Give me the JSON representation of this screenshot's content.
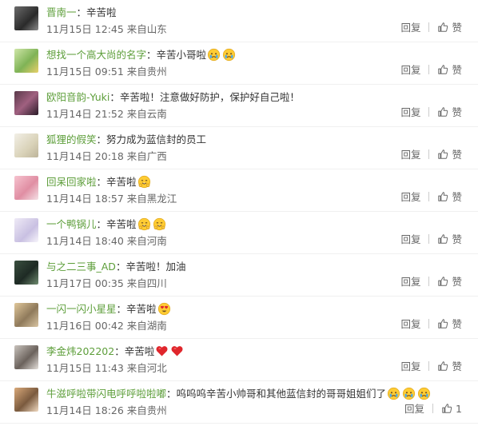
{
  "comments": [
    {
      "user": "晋南一",
      "text": "辛苦啦",
      "emojis": [],
      "time": "11月15日 12:45",
      "location": "来自山东",
      "reply": "回复",
      "like": "赞"
    },
    {
      "user": "想找一个高大尚的名字",
      "text": "辛苦小哥啦",
      "emojis": [
        "crying-face",
        "crying-face"
      ],
      "time": "11月15日 09:51",
      "location": "来自贵州",
      "reply": "回复",
      "like": "赞"
    },
    {
      "user": "欧阳音韵-Yuki",
      "text": "辛苦啦！注意做好防护，保护好自己啦！",
      "emojis": [],
      "time": "11月14日 21:52",
      "location": "来自云南",
      "reply": "回复",
      "like": "赞"
    },
    {
      "user": "狐狸的假笑",
      "text": "努力成为蓝信封的员工",
      "emojis": [],
      "time": "11月14日 20:18",
      "location": "来自广西",
      "reply": "回复",
      "like": "赞"
    },
    {
      "user": "回呆回家啦",
      "text": "辛苦啦",
      "emojis": [
        "hug-face"
      ],
      "time": "11月14日 18:57",
      "location": "来自黑龙江",
      "reply": "回复",
      "like": "赞"
    },
    {
      "user": "一个鸭锅儿",
      "text": "辛苦啦",
      "emojis": [
        "hug-face",
        "hug-face"
      ],
      "time": "11月14日 18:40",
      "location": "来自河南",
      "reply": "回复",
      "like": "赞"
    },
    {
      "user": "与之二三事_AD",
      "text": "辛苦啦！加油",
      "emojis": [],
      "time": "11月17日 00:35",
      "location": "来自四川",
      "reply": "回复",
      "like": "赞"
    },
    {
      "user": "一闪一闪小星星",
      "text": "辛苦啦",
      "emojis": [
        "heart-eyes-face"
      ],
      "time": "11月16日 00:42",
      "location": "来自湖南",
      "reply": "回复",
      "like": "赞"
    },
    {
      "user": "李金炜202202",
      "text": "辛苦啦",
      "emojis": [
        "red-heart",
        "red-heart"
      ],
      "time": "11月15日 11:43",
      "location": "来自河北",
      "reply": "回复",
      "like": "赞"
    },
    {
      "user": "牛滋呼啦带闪电呼呼啦啦嘟",
      "text": "呜呜呜辛苦小帅哥和其他蓝信封的哥哥姐姐们了",
      "emojis": [
        "crying-face",
        "crying-face",
        "crying-face"
      ],
      "time": "11月14日 18:26",
      "location": "来自贵州",
      "reply": "回复",
      "like": "1"
    }
  ],
  "colors": {
    "username": "#5d9e3a",
    "meta": "#666666",
    "divider": "#f0f0f0"
  }
}
